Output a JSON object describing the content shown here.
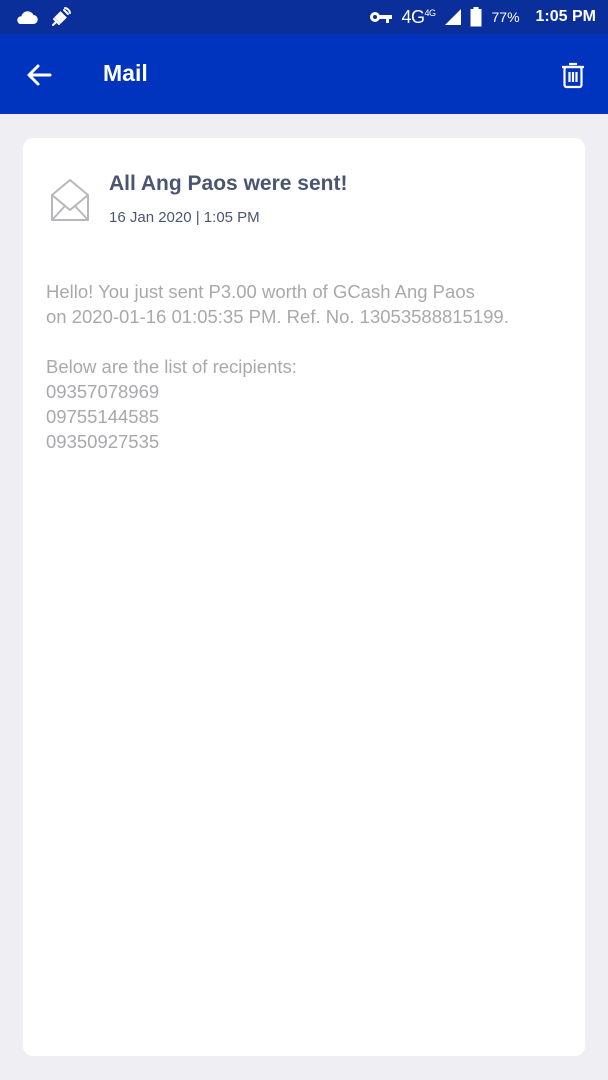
{
  "status_bar": {
    "network": "4G",
    "network_secondary": "4G",
    "battery": "77%",
    "time": "1:05 PM",
    "icons": [
      "cloud-icon",
      "satellite-icon",
      "key-icon",
      "signal-icon",
      "battery-icon"
    ]
  },
  "app_bar": {
    "title": "Mail",
    "back_icon": "arrow-left-icon",
    "delete_icon": "trash-icon"
  },
  "mail": {
    "icon": "open-envelope-icon",
    "subject": "All Ang Paos were sent!",
    "date": "16 Jan 2020 | 1:05 PM",
    "body_line_1": "Hello! You just sent P3.00 worth of GCash Ang Paos",
    "body_line_2": "on 2020-01-16 01:05:35 PM. Ref. No. 13053588815199.",
    "recipients_heading": "Below are the list of recipients:",
    "recipients": [
      "09357078969",
      "09755144585",
      "09350927535"
    ]
  },
  "colors": {
    "status_bar_bg": "#0a2f9a",
    "app_bar_bg": "#0033be",
    "page_bg": "#eeeef3",
    "subject_text": "#4a5670",
    "body_text": "#a9a9ad"
  }
}
